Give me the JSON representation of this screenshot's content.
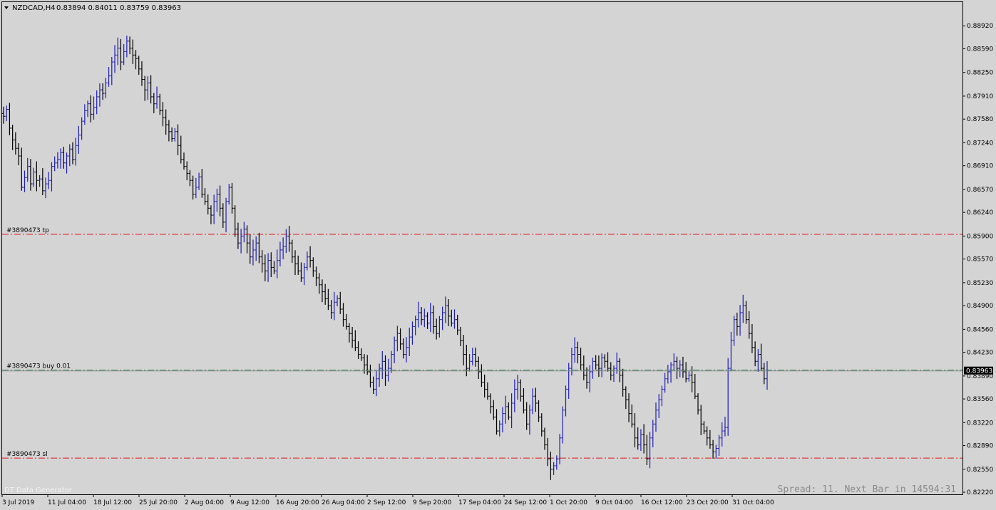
{
  "header": {
    "symbol": "NZDCAD,H4",
    "ohlc": "0.83894 0.84011 0.83759 0.83963",
    "collapse_icon": "triangle-down-icon"
  },
  "colors": {
    "background": "#d4d4d4",
    "frame": "#000000",
    "bar_bull": "#1f1fb6",
    "bar_bear": "#000000",
    "level_red": "#e01818",
    "level_green": "#2e8b57",
    "price_line": "#8a8a8a",
    "price_box_bg": "#000000",
    "price_box_fg": "#ffffff",
    "footer_text": "#f2f2f2",
    "spread_text": "#8a8a8a"
  },
  "levels": [
    {
      "label": "#3890473 tp",
      "price": 0.85925,
      "style": "dashdot",
      "color": "#e01818"
    },
    {
      "label": "#3890473 buy 0.01",
      "price": 0.83975,
      "style": "dashdot",
      "color": "#2e8b57"
    },
    {
      "label": "#3890473 sl",
      "price": 0.8271,
      "style": "dashdot",
      "color": "#e01818"
    }
  ],
  "current_price": "0.83963",
  "footer": {
    "watermark": "DT Data Generator",
    "spread": "Spread: 11. Next Bar in 14594:31"
  },
  "chart_data": {
    "type": "ohlc",
    "title": "NZDCAD,H4",
    "ylim": [
      0.8219,
      0.8926
    ],
    "y_ticks": [
      "0.88920",
      "0.88590",
      "0.88250",
      "0.87910",
      "0.87580",
      "0.87240",
      "0.86910",
      "0.86570",
      "0.86240",
      "0.85900",
      "0.85570",
      "0.85230",
      "0.84900",
      "0.84560",
      "0.84230",
      "0.83890",
      "0.83560",
      "0.83220",
      "0.82890",
      "0.82550",
      "0.82220"
    ],
    "x_ticks": [
      "3 Jul 2019",
      "11 Jul 04:00",
      "18 Jul 12:00",
      "25 Jul 20:00",
      "2 Aug 04:00",
      "9 Aug 12:00",
      "16 Aug 20:00",
      "26 Aug 04:00",
      "2 Sep 12:00",
      "9 Sep 20:00",
      "17 Sep 04:00",
      "24 Sep 12:00",
      "1 Oct 20:00",
      "9 Oct 04:00",
      "16 Oct 12:00",
      "23 Oct 20:00",
      "31 Oct 04:00"
    ],
    "grid": false,
    "series": [
      {
        "values": [
          0.8762,
          0.8772,
          0.8745,
          0.8728,
          0.8716,
          0.8705,
          0.866,
          0.8674,
          0.869,
          0.8665,
          0.8682,
          0.867,
          0.8672,
          0.8655,
          0.8665,
          0.867,
          0.869,
          0.8695,
          0.87,
          0.871,
          0.8695,
          0.8705,
          0.8715,
          0.87,
          0.872,
          0.8735,
          0.8755,
          0.877,
          0.878,
          0.8765,
          0.8775,
          0.879,
          0.88,
          0.8795,
          0.881,
          0.882,
          0.884,
          0.885,
          0.886,
          0.884,
          0.8855,
          0.887,
          0.886,
          0.885,
          0.8845,
          0.883,
          0.8815,
          0.88,
          0.881,
          0.879,
          0.878,
          0.879,
          0.877,
          0.876,
          0.875,
          0.874,
          0.873,
          0.874,
          0.872,
          0.87,
          0.869,
          0.868,
          0.867,
          0.865,
          0.866,
          0.8675,
          0.865,
          0.864,
          0.863,
          0.862,
          0.864,
          0.865,
          0.863,
          0.861,
          0.864,
          0.866,
          0.863,
          0.86,
          0.858,
          0.859,
          0.86,
          0.858,
          0.856,
          0.857,
          0.858,
          0.856,
          0.855,
          0.854,
          0.8555,
          0.8545,
          0.854,
          0.8555,
          0.857,
          0.8575,
          0.859,
          0.858,
          0.856,
          0.855,
          0.854,
          0.853,
          0.8545,
          0.856,
          0.8555,
          0.854,
          0.853,
          0.852,
          0.851,
          0.85,
          0.849,
          0.848,
          0.8495,
          0.85,
          0.8485,
          0.847,
          0.846,
          0.845,
          0.844,
          0.843,
          0.842,
          0.8415,
          0.8405,
          0.8395,
          0.838,
          0.837,
          0.8385,
          0.84,
          0.841,
          0.839,
          0.84,
          0.842,
          0.844,
          0.845,
          0.8435,
          0.842,
          0.843,
          0.8445,
          0.846,
          0.847,
          0.848,
          0.847,
          0.8475,
          0.8465,
          0.848,
          0.846,
          0.845,
          0.847,
          0.848,
          0.849,
          0.8475,
          0.8465,
          0.847,
          0.8455,
          0.844,
          0.842,
          0.84,
          0.841,
          0.842,
          0.841,
          0.8395,
          0.838,
          0.837,
          0.836,
          0.8345,
          0.833,
          0.831,
          0.832,
          0.8335,
          0.8345,
          0.833,
          0.835,
          0.837,
          0.838,
          0.836,
          0.834,
          0.832,
          0.834,
          0.836,
          0.835,
          0.833,
          0.831,
          0.829,
          0.827,
          0.8255,
          0.826,
          0.827,
          0.83,
          0.834,
          0.837,
          0.84,
          0.842,
          0.843,
          0.842,
          0.8405,
          0.839,
          0.838,
          0.8395,
          0.841,
          0.8405,
          0.84,
          0.8415,
          0.841,
          0.84,
          0.839,
          0.84,
          0.841,
          0.839,
          0.837,
          0.8355,
          0.8335,
          0.832,
          0.83,
          0.829,
          0.8305,
          0.829,
          0.827,
          0.83,
          0.832,
          0.834,
          0.8355,
          0.837,
          0.8385,
          0.8395,
          0.8405,
          0.841,
          0.84,
          0.8405,
          0.8395,
          0.8385,
          0.839,
          0.838,
          0.836,
          0.834,
          0.832,
          0.831,
          0.83,
          0.829,
          0.828,
          0.8285,
          0.83,
          0.831,
          0.8315,
          0.84,
          0.844,
          0.847,
          0.846,
          0.848,
          0.849,
          0.847,
          0.845,
          0.843,
          0.841,
          0.842,
          0.84,
          0.8385,
          0.83963
        ]
      }
    ]
  }
}
